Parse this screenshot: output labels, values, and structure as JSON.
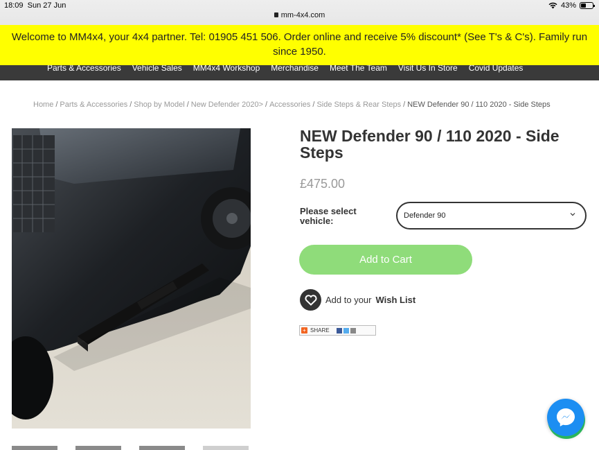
{
  "status_bar": {
    "time": "18:09",
    "date": "Sun 27 Jun",
    "battery": "43%"
  },
  "browser": {
    "url": "mm-4x4.com"
  },
  "promo": {
    "text": "Welcome to MM4x4, your 4x4 partner. Tel: 01905 451 506. Order online and receive 5% discount* (See T's & C's). Family run since 1950."
  },
  "nav": {
    "items": [
      "Parts & Accessories",
      "Vehicle Sales",
      "MM4x4 Workshop",
      "Merchandise",
      "Meet The Team",
      "Visit Us In Store",
      "Covid Updates"
    ]
  },
  "breadcrumb": {
    "items": [
      "Home",
      "Parts & Accessories",
      "Shop by Model",
      "New Defender 2020>",
      "Accessories",
      "Side Steps & Rear Steps"
    ],
    "current": "NEW Defender 90 / 110 2020 - Side Steps"
  },
  "product": {
    "title": "NEW Defender 90 / 110 2020 - Side Steps",
    "price": "£475.00",
    "select_label": "Please select vehicle:",
    "selected_vehicle": "Defender 90",
    "add_to_cart": "Add to Cart",
    "wishlist_prefix": "Add to your",
    "wishlist_bold": "Wish List",
    "share_label": "SHARE"
  },
  "colors": {
    "banner": "#ffff00",
    "nav": "#3a3a3a",
    "cart_button": "#8fdc7a",
    "messenger": "#1c8ef2"
  },
  "icons": [
    "lock-icon",
    "wifi-icon",
    "battery-icon",
    "chevron-down-icon",
    "heart-icon",
    "share-plus-icon",
    "messenger-icon"
  ]
}
